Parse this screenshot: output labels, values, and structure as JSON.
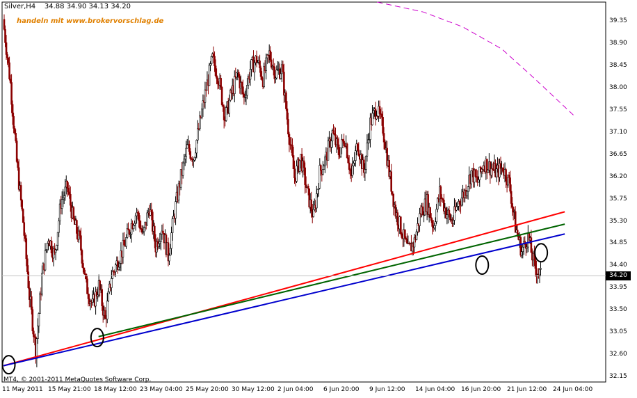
{
  "header": {
    "symbol_timeframe": "Silver,H4",
    "ohlc": "34.88 34.90 34.13 34.20"
  },
  "watermark": "handeln mit www.brokervorschlag.de",
  "copyright": "MT4, © 2001-2011 MetaQuotes Software Corp.",
  "current_price_label": "34.20",
  "colors": {
    "background": "#ffffff",
    "bull_candle": "#000000",
    "bear_candle": "#8b0000",
    "trend_red": "#ff0000",
    "trend_green": "#006400",
    "trend_blue": "#0000cd",
    "arc_magenta": "#cc00cc",
    "watermark": "#e08000"
  },
  "chart_data": {
    "type": "candlestick",
    "y_axis_ticks": [
      "39.35",
      "38.90",
      "38.45",
      "38.00",
      "37.55",
      "37.10",
      "36.65",
      "36.20",
      "35.75",
      "35.30",
      "34.85",
      "34.40",
      "33.95",
      "33.50",
      "33.05",
      "32.60",
      "32.15"
    ],
    "x_axis_ticks": [
      "11 May 2011",
      "15 May 21:00",
      "18 May 12:00",
      "23 May 04:00",
      "25 May 20:00",
      "30 May 12:00",
      "2 Jun 04:00",
      "6 Jun 20:00",
      "9 Jun 12:00",
      "14 Jun 04:00",
      "16 Jun 20:00",
      "21 Jun 12:00",
      "24 Jun 04:00"
    ],
    "ylim": [
      32.05,
      39.75
    ],
    "close_path": [
      39.2,
      38.1,
      36.5,
      35.3,
      33.8,
      32.7,
      34.2,
      35.0,
      34.6,
      35.7,
      36.0,
      35.3,
      34.9,
      34.0,
      33.6,
      34.0,
      33.3,
      34.2,
      34.5,
      34.8,
      35.2,
      35.5,
      35.0,
      35.6,
      34.8,
      35.2,
      34.6,
      35.5,
      36.2,
      36.8,
      36.6,
      37.3,
      38.0,
      38.6,
      38.2,
      37.4,
      37.9,
      38.3,
      37.8,
      38.4,
      38.6,
      38.2,
      38.7,
      38.3,
      38.4,
      37.2,
      36.2,
      36.6,
      35.9,
      35.4,
      36.3,
      36.6,
      37.1,
      36.7,
      37.0,
      36.2,
      36.9,
      36.3,
      37.3,
      37.6,
      37.2,
      36.3,
      35.5,
      35.1,
      34.7,
      34.9,
      35.5,
      35.7,
      35.2,
      35.9,
      35.5,
      35.3,
      35.7,
      35.9,
      36.3,
      36.1,
      36.5,
      36.4,
      36.3,
      36.4,
      36.1,
      35.2,
      34.7,
      35.0,
      34.4,
      34.2
    ],
    "annotations": [
      {
        "kind": "trendline",
        "color": "#ff0000",
        "from": [
          0,
          32.38
        ],
        "to": [
          85.6,
          35.5
        ]
      },
      {
        "kind": "trendline",
        "color": "#006400",
        "from": [
          14.5,
          32.97
        ],
        "to": [
          85.6,
          35.25
        ]
      },
      {
        "kind": "trendline",
        "color": "#0000cd",
        "from": [
          0,
          32.38
        ],
        "to": [
          85.6,
          35.05
        ]
      },
      {
        "kind": "circle",
        "at": [
          0.8,
          32.4
        ]
      },
      {
        "kind": "circle",
        "at": [
          14.3,
          32.95
        ]
      },
      {
        "kind": "circle",
        "at": [
          82.0,
          34.67
        ]
      },
      {
        "kind": "circle",
        "at": [
          73.0,
          34.42
        ]
      },
      {
        "kind": "arc",
        "color": "#cc00cc",
        "points": [
          [
            57.0,
            39.75
          ],
          [
            64.0,
            39.55
          ],
          [
            70.0,
            39.25
          ],
          [
            76.0,
            38.8
          ],
          [
            81.0,
            38.2
          ],
          [
            85.0,
            37.7
          ],
          [
            87.0,
            37.45
          ]
        ]
      }
    ]
  }
}
